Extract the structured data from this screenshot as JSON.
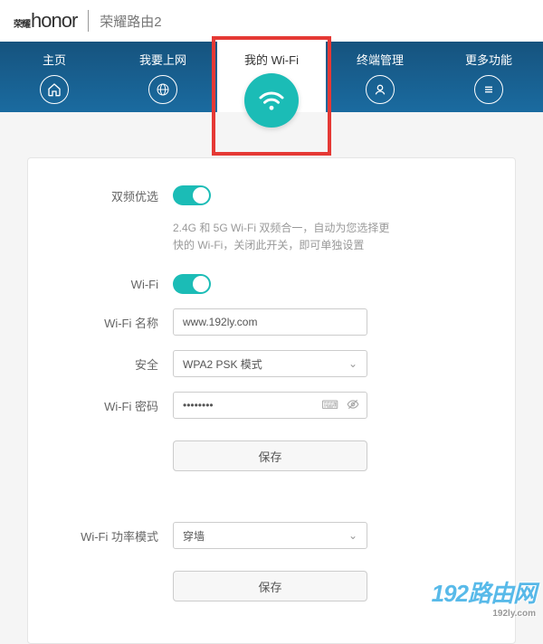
{
  "header": {
    "brand_prefix": "荣耀",
    "brand": "honor",
    "product": "荣耀路由2"
  },
  "nav": {
    "home": "主页",
    "wan": "我要上网",
    "wifi": "我的 Wi-Fi",
    "devices": "终端管理",
    "more": "更多功能"
  },
  "form": {
    "dualband_label": "双频优选",
    "dualband_desc": "2.4G 和 5G Wi-Fi 双频合一，自动为您选择更快的 Wi-Fi，关闭此开关，即可单独设置",
    "wifi_switch_label": "Wi-Fi",
    "ssid_label": "Wi-Fi 名称",
    "ssid_value": "www.192ly.com",
    "security_label": "安全",
    "security_value": "WPA2 PSK 模式",
    "pwd_label": "Wi-Fi 密码",
    "pwd_value": "••••••••",
    "save": "保存",
    "power_label": "Wi-Fi 功率模式",
    "power_value": "穿墙",
    "save2": "保存"
  },
  "watermark": {
    "main": "192路由网",
    "sub": "192ly.com"
  }
}
